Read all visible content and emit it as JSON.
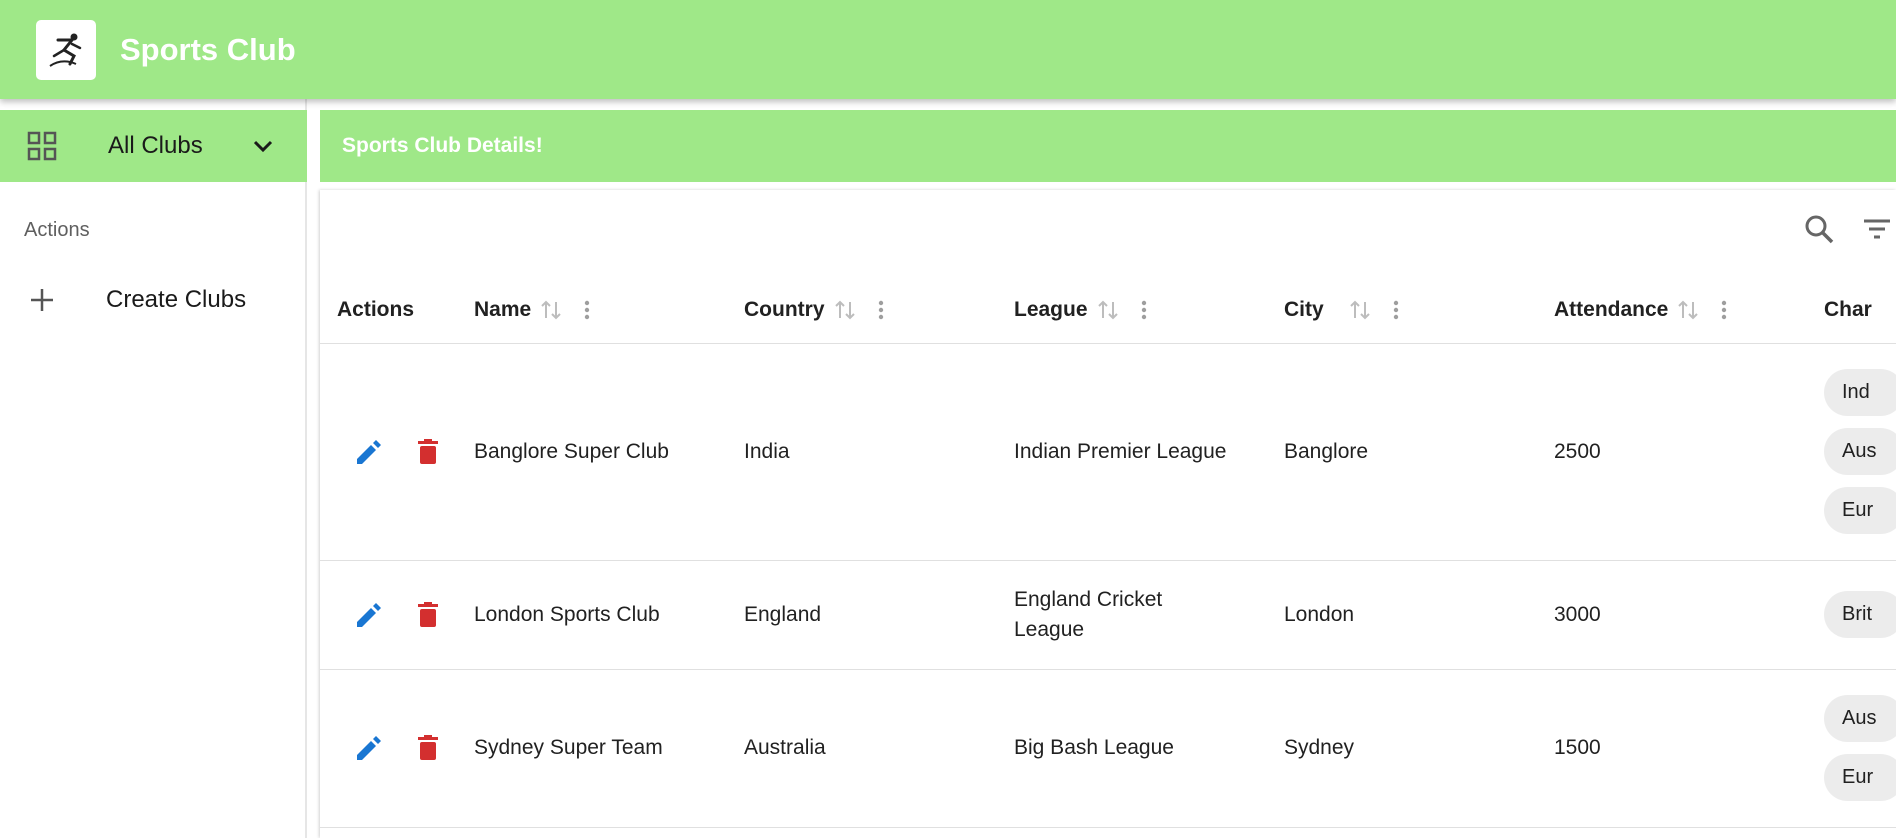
{
  "app": {
    "title": "Sports Club",
    "logo_icon": "runner-logo-icon"
  },
  "sidebar": {
    "menu_label": "All Clubs",
    "section_label": "Actions",
    "items": [
      {
        "label": "Create Clubs",
        "icon": "plus-icon"
      }
    ]
  },
  "main": {
    "header_title": "Sports Club Details!",
    "columns": [
      "Actions",
      "Name",
      "Country",
      "League",
      "City",
      "Attendance",
      "Char"
    ],
    "rows": [
      {
        "name": "Banglore Super Club",
        "country": "India",
        "league": "Indian Premier League",
        "city": "Banglore",
        "attendance": "2500",
        "chips": [
          "Ind",
          "Aus",
          "Eur"
        ]
      },
      {
        "name": "London Sports Club",
        "country": "England",
        "league": "England Cricket League",
        "city": "London",
        "attendance": "3000",
        "chips": [
          "Brit"
        ]
      },
      {
        "name": "Sydney Super Team",
        "country": "Australia",
        "league": "Big Bash League",
        "city": "Sydney",
        "attendance": "1500",
        "chips": [
          "Aus",
          "Eur"
        ]
      }
    ]
  },
  "colors": {
    "header_green": "#9fe888",
    "edit_blue": "#1976d2",
    "delete_red": "#d32f2f"
  }
}
